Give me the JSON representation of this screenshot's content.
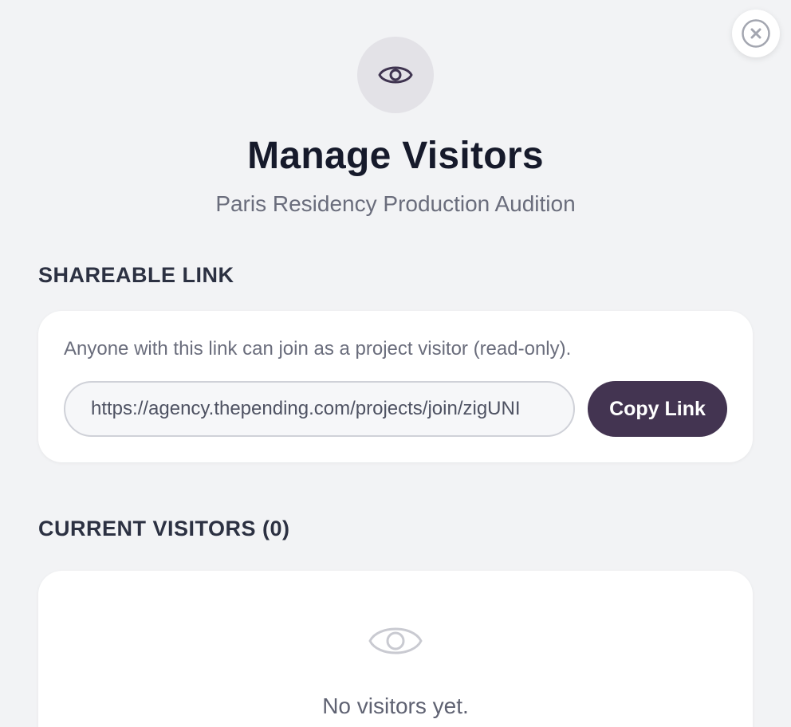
{
  "header": {
    "icon": "eye-icon",
    "title": "Manage Visitors",
    "subtitle": "Paris Residency Production Audition",
    "close_icon": "close-icon"
  },
  "share": {
    "section_label": "SHAREABLE LINK",
    "description": "Anyone with this link can join as a project visitor (read-only).",
    "link_value": "https://agency.thepending.com/projects/join/zigUNI",
    "copy_label": "Copy Link"
  },
  "visitors": {
    "section_label": "CURRENT VISITORS (0)",
    "empty_icon": "eye-icon",
    "empty_text": "No visitors yet."
  },
  "colors": {
    "accent": "#433451",
    "background": "#f2f3f5"
  }
}
